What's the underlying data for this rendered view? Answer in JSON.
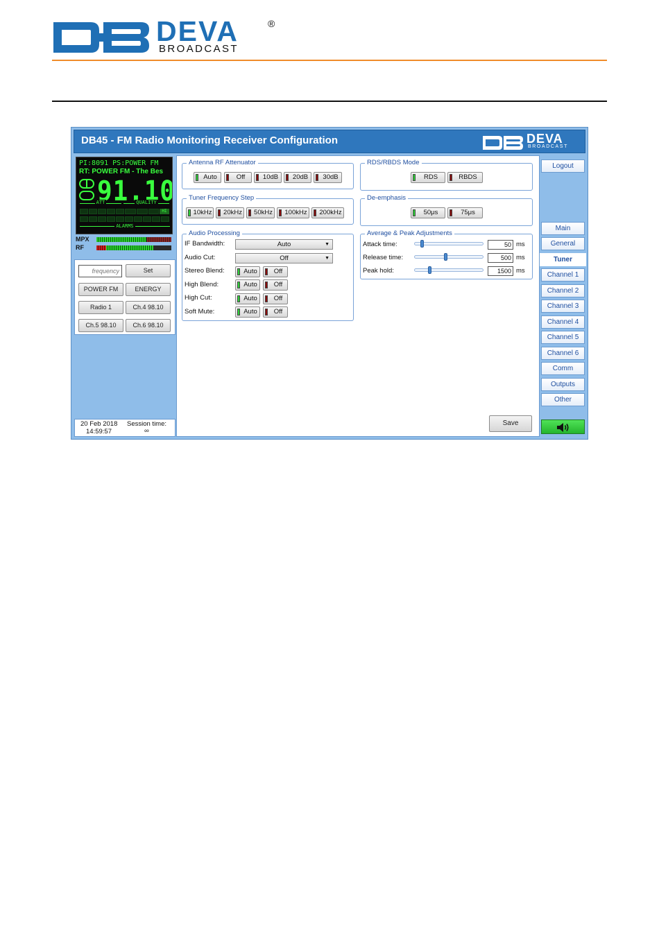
{
  "doc": {
    "logo_name": "DEVA",
    "logo_reg": "®",
    "logo_sub": "BROADCAST"
  },
  "app": {
    "title": "DB45 - FM Radio Monitoring Receiver Configuration",
    "logo_name": "DEVA",
    "logo_sub": "BROADCAST"
  },
  "lcd": {
    "line1": "PI:8091 PS:POWER  FM",
    "line2": "RT: POWER FM - The Bes",
    "frequency": "91.10",
    "att_label": "ATT",
    "quality_label": "QUALITY",
    "hi_label": "HI",
    "alarms_label": "ALARMS"
  },
  "meters": {
    "mpx_label": "MPX",
    "mpx_level": 0.67,
    "rf_label": "RF",
    "rf_level": 0.72
  },
  "quick": {
    "frequency_placeholder": "frequency",
    "set_label": "Set",
    "presets": [
      "POWER FM",
      "ENERGY",
      "Radio 1",
      "Ch.4 98.10",
      "Ch.5 98.10",
      "Ch.6 98.10"
    ]
  },
  "clock": {
    "date": "20 Feb 2018",
    "time": "14:59:57",
    "session_label": "Session time:",
    "session_value": "∞"
  },
  "antenna": {
    "title": "Antenna RF Attenuator",
    "options": [
      "Auto",
      "Off",
      "10dB",
      "20dB",
      "30dB"
    ],
    "selected": "Auto"
  },
  "step": {
    "title": "Tuner Frequency Step",
    "options": [
      "10kHz",
      "20kHz",
      "50kHz",
      "100kHz",
      "200kHz"
    ],
    "selected": "10kHz"
  },
  "rds": {
    "title": "RDS/RBDS Mode",
    "options": [
      "RDS",
      "RBDS"
    ],
    "selected": "RDS"
  },
  "deemph": {
    "title": "De-emphasis",
    "options": [
      "50μs",
      "75μs"
    ],
    "selected": "50μs"
  },
  "audio": {
    "title": "Audio Processing",
    "if_bandwidth_label": "IF Bandwidth:",
    "if_bandwidth_value": "Auto",
    "audio_cut_label": "Audio Cut:",
    "audio_cut_value": "Off",
    "toggle_auto": "Auto",
    "toggle_off": "Off",
    "rows": [
      {
        "label": "Stereo Blend:",
        "selected": "Auto"
      },
      {
        "label": "High Blend:",
        "selected": "Auto"
      },
      {
        "label": "High Cut:",
        "selected": "Auto"
      },
      {
        "label": "Soft Mute:",
        "selected": "Auto"
      }
    ]
  },
  "peak": {
    "title": "Average & Peak Adjustments",
    "unit": "ms",
    "rows": [
      {
        "label": "Attack time:",
        "value": "50",
        "level": 0.08
      },
      {
        "label": "Release time:",
        "value": "500",
        "level": 0.45
      },
      {
        "label": "Peak hold:",
        "value": "1500",
        "level": 0.2
      }
    ]
  },
  "save_label": "Save",
  "nav": {
    "logout": "Logout",
    "items": [
      "Main",
      "General",
      "Tuner",
      "Channel 1",
      "Channel 2",
      "Channel 3",
      "Channel 4",
      "Channel 5",
      "Channel 6",
      "Comm",
      "Outputs",
      "Other"
    ],
    "active": "Tuner"
  },
  "colors": {
    "accent_blue": "#2f77bd",
    "led_on": "#2fd33a",
    "led_off": "#8b0d0d",
    "lcd_green": "#39ff3e",
    "doc_rule_orange": "#f08c2a"
  }
}
